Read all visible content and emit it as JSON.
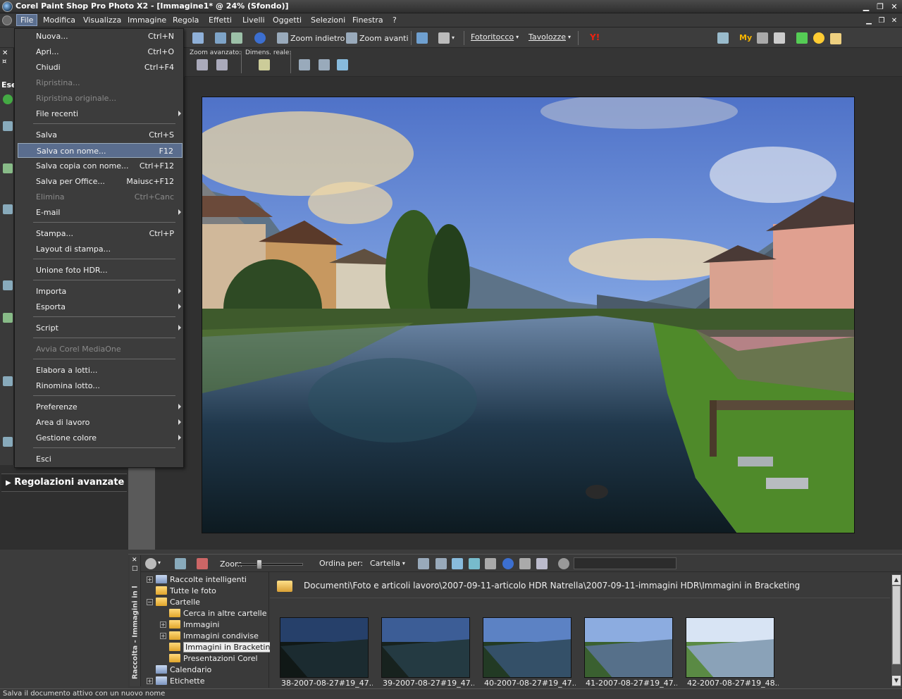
{
  "app": {
    "title": "Corel Paint Shop Pro Photo X2 - [Immagine1* @  24% (Sfondo)]"
  },
  "menubar": {
    "items": [
      {
        "label": "File"
      },
      {
        "label": "Modifica"
      },
      {
        "label": "Visualizza"
      },
      {
        "label": "Immagine"
      },
      {
        "label": "Regola"
      },
      {
        "label": "Effetti"
      },
      {
        "label": "Livelli"
      },
      {
        "label": "Oggetti"
      },
      {
        "label": "Selezioni"
      },
      {
        "label": "Finestra"
      },
      {
        "label": "?"
      }
    ]
  },
  "toolbar": {
    "zoom_out": "Zoom indietro",
    "zoom_in": "Zoom avanti",
    "photocopy": "Fotoritocco",
    "tablets": "Tavolozze",
    "my_label": "My",
    "zoom_advanced": "Zoom avanzato:",
    "actual_size": "Dimens. reale:"
  },
  "file_menu": {
    "items": [
      {
        "label": "Nuova...",
        "shortcut": "Ctrl+N",
        "disabled": false
      },
      {
        "label": "Apri...",
        "shortcut": "Ctrl+O",
        "disabled": false
      },
      {
        "label": "Chiudi",
        "shortcut": "Ctrl+F4",
        "disabled": false
      },
      {
        "label": "Ripristina...",
        "shortcut": "",
        "disabled": true
      },
      {
        "label": "Ripristina originale...",
        "shortcut": "",
        "disabled": true
      },
      {
        "label": "File recenti",
        "shortcut": "",
        "disabled": false,
        "submenu": true
      },
      {
        "label": "Salva",
        "shortcut": "Ctrl+S",
        "disabled": false
      },
      {
        "label": "Salva con nome...",
        "shortcut": "F12",
        "disabled": false,
        "selected": true
      },
      {
        "label": "Salva copia con nome...",
        "shortcut": "Ctrl+F12",
        "disabled": false
      },
      {
        "label": "Salva per Office...",
        "shortcut": "Maiusc+F12",
        "disabled": false
      },
      {
        "label": "Elimina",
        "shortcut": "Ctrl+Canc",
        "disabled": true
      },
      {
        "label": "E-mail",
        "shortcut": "",
        "disabled": false,
        "submenu": true
      },
      {
        "label": "Stampa...",
        "shortcut": "Ctrl+P",
        "disabled": false
      },
      {
        "label": "Layout di stampa...",
        "shortcut": "",
        "disabled": false
      },
      {
        "label": "Unione foto HDR...",
        "shortcut": "",
        "disabled": false
      },
      {
        "label": "Importa",
        "shortcut": "",
        "disabled": false,
        "submenu": true
      },
      {
        "label": "Esporta",
        "shortcut": "",
        "disabled": false,
        "submenu": true
      },
      {
        "label": "Script",
        "shortcut": "",
        "disabled": false,
        "submenu": true
      },
      {
        "label": "Avvia Corel MediaOne",
        "shortcut": "",
        "disabled": true
      },
      {
        "label": "Elabora a lotti...",
        "shortcut": "",
        "disabled": false
      },
      {
        "label": "Rinomina lotto...",
        "shortcut": "",
        "disabled": false
      },
      {
        "label": "Preferenze",
        "shortcut": "",
        "disabled": false,
        "submenu": true
      },
      {
        "label": "Area di lavoro",
        "shortcut": "",
        "disabled": false,
        "submenu": true
      },
      {
        "label": "Gestione colore",
        "shortcut": "",
        "disabled": false,
        "submenu": true
      },
      {
        "label": "Esci",
        "shortcut": "",
        "disabled": false
      }
    ]
  },
  "left_panel": {
    "tab_label": "Ese",
    "advanced_header": "Regolazioni avanzate"
  },
  "organizer": {
    "side_title": "Raccolta - Immagini in l",
    "zoom_label": "Zoom",
    "sort_label": "Ordina per:",
    "sort_value": "Cartella",
    "path": "Documenti\\Foto e articoli lavoro\\2007-09-11-articolo HDR Natrella\\2007-09-11-immagini HDR\\Immagini in Bracketing",
    "tree": [
      {
        "label": "Raccolte intelligenti",
        "expander": "+"
      },
      {
        "label": "Tutte le foto",
        "expander": ""
      },
      {
        "label": "Cartelle",
        "expander": "−"
      },
      {
        "label": "Cerca in altre cartelle",
        "expander": ""
      },
      {
        "label": "Immagini",
        "expander": "+"
      },
      {
        "label": "Immagini condivise",
        "expander": "+"
      },
      {
        "label": "Immagini in Bracketing",
        "expander": "",
        "selected": true
      },
      {
        "label": "Presentazioni Corel",
        "expander": ""
      },
      {
        "label": "Calendario",
        "expander": ""
      },
      {
        "label": "Etichette",
        "expander": "+"
      }
    ],
    "thumbnails": [
      {
        "caption": "38-2007-08-27#19_47..."
      },
      {
        "caption": "39-2007-08-27#19_47..."
      },
      {
        "caption": "40-2007-08-27#19_47..."
      },
      {
        "caption": "41-2007-08-27#19_47..."
      },
      {
        "caption": "42-2007-08-27#19_48..."
      }
    ]
  },
  "status": {
    "text": "Salva il documento attivo con un nuovo nome"
  },
  "colors": {
    "menu_highlight": "#5a6d8e",
    "panel_bg": "#3a3a3a"
  }
}
